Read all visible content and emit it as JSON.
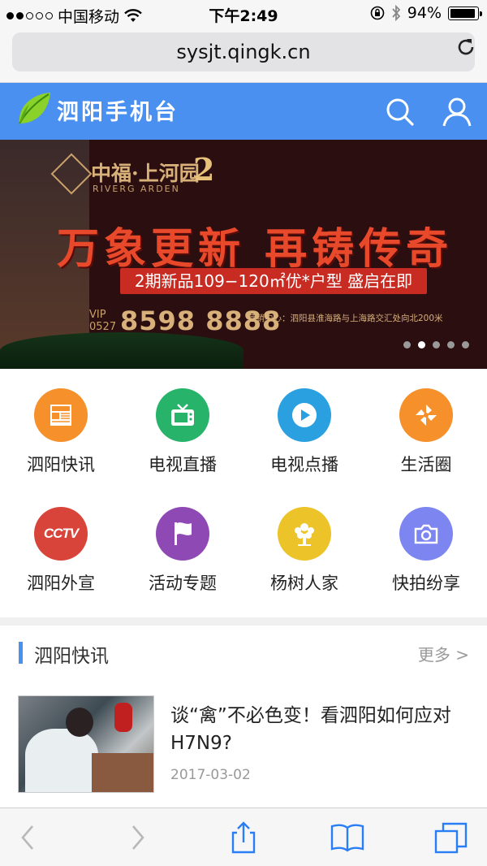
{
  "status_bar": {
    "carrier": "中国移动",
    "time": "下午2:49",
    "battery_percent": "94%",
    "battery_level": 0.94
  },
  "browser": {
    "url": "sysjt.qingk.cn"
  },
  "header": {
    "site_name": "泗阳手机台",
    "accent_color": "#4a90f0",
    "icons": [
      "search-icon",
      "user-icon"
    ]
  },
  "banner": {
    "brand": "中福·上河园",
    "brand_en": "RIVERG ARDEN",
    "phase_mark": "2",
    "slogan": "万象更新 再铸传奇",
    "promo": "2期新品109−120㎡优*户型 盛启在即",
    "vip_label": "VIP",
    "area_code": "0527",
    "phone": "8598 8888",
    "sales_center": "营销中心：泗阳县淮海路与上海路交汇处向北200米",
    "slide_count": 5,
    "active_slide": 2
  },
  "grid": [
    {
      "label": "泗阳快讯",
      "icon": "news-icon",
      "color": "#f5902a"
    },
    {
      "label": "电视直播",
      "icon": "tv-icon",
      "color": "#27b36a"
    },
    {
      "label": "电视点播",
      "icon": "play-icon",
      "color": "#2aa0e0"
    },
    {
      "label": "生活圈",
      "icon": "pinwheel-icon",
      "color": "#f5902a"
    },
    {
      "label": "泗阳外宣",
      "icon": "cctv-icon",
      "color": "#d9443a",
      "badge": "CCTV"
    },
    {
      "label": "活动专题",
      "icon": "flag-icon",
      "color": "#8e49b5"
    },
    {
      "label": "杨树人家",
      "icon": "tree-icon",
      "color": "#edc32a"
    },
    {
      "label": "快拍纷享",
      "icon": "camera-icon",
      "color": "#7d86f0"
    }
  ],
  "news_section": {
    "title": "泗阳快讯",
    "more": "更多 >",
    "items": [
      {
        "title": "谈“禽”不必色变！看泗阳如何应对H7N9?",
        "date": "2017-03-02"
      }
    ]
  },
  "toolbar": {
    "icons": [
      "back-icon",
      "forward-icon",
      "share-icon",
      "bookmarks-icon",
      "tabs-icon"
    ]
  }
}
